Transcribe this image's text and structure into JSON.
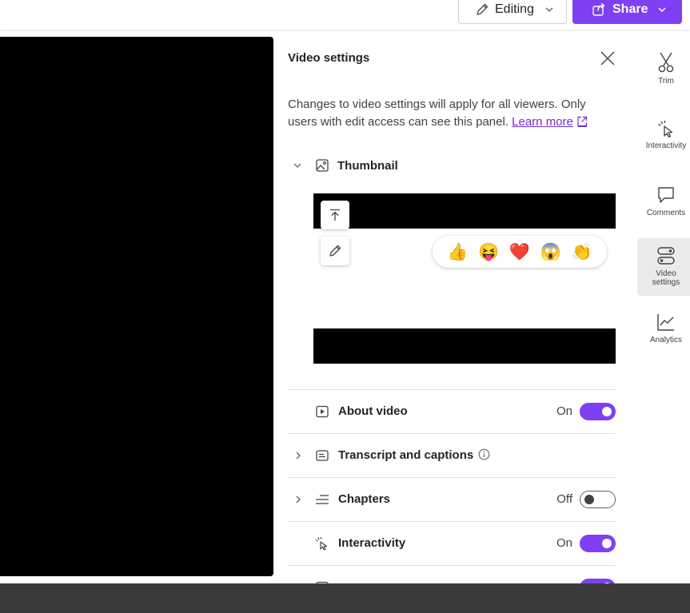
{
  "topbar": {
    "editing_label": "Editing",
    "share_label": "Share"
  },
  "panel": {
    "title": "Video settings",
    "description": "Changes to video settings will apply for all viewers. Only users with edit access can see this panel.",
    "learn_more": "Learn more",
    "thumbnail_label": "Thumbnail",
    "reactions": [
      "👍",
      "😝",
      "❤️",
      "😱",
      "👏"
    ],
    "rows": [
      {
        "label": "About video",
        "state": "On"
      },
      {
        "label": "Transcript and captions"
      },
      {
        "label": "Chapters",
        "state": "Off"
      },
      {
        "label": "Interactivity",
        "state": "On"
      }
    ]
  },
  "rail": {
    "items": [
      {
        "label": "Trim",
        "icon": "scissors-icon"
      },
      {
        "label": "Interactivity",
        "icon": "cursor-click-icon"
      },
      {
        "label": "Comments",
        "icon": "comment-icon"
      },
      {
        "label": "Video settings",
        "icon": "toggle-settings-icon"
      },
      {
        "label": "Analytics",
        "icon": "chart-line-icon"
      }
    ]
  },
  "colors": {
    "accent": "#7f3ff2",
    "link": "#6b2fd6",
    "bottom_bar": "#3a3a3a"
  }
}
